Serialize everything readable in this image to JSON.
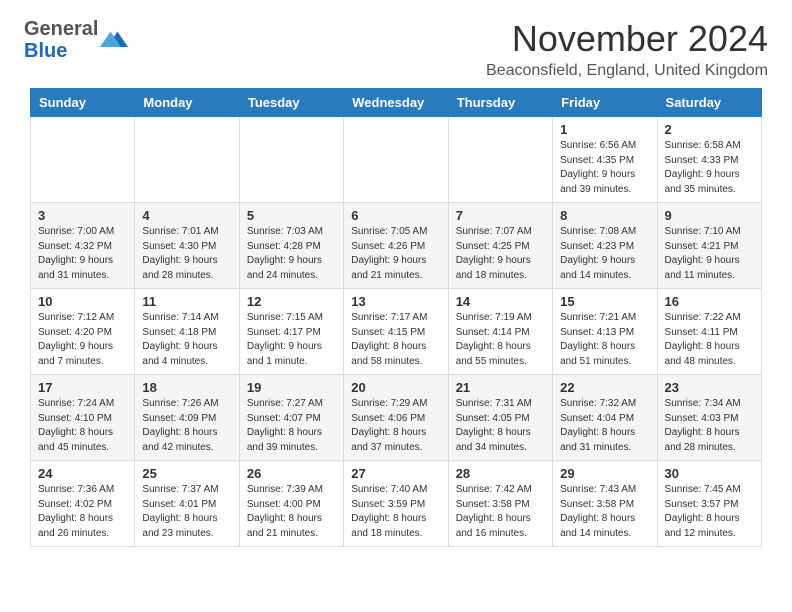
{
  "header": {
    "logo_general": "General",
    "logo_blue": "Blue",
    "month_title": "November 2024",
    "location": "Beaconsfield, England, United Kingdom"
  },
  "weekdays": [
    "Sunday",
    "Monday",
    "Tuesday",
    "Wednesday",
    "Thursday",
    "Friday",
    "Saturday"
  ],
  "weeks": [
    [
      {
        "day": "",
        "info": ""
      },
      {
        "day": "",
        "info": ""
      },
      {
        "day": "",
        "info": ""
      },
      {
        "day": "",
        "info": ""
      },
      {
        "day": "",
        "info": ""
      },
      {
        "day": "1",
        "info": "Sunrise: 6:56 AM\nSunset: 4:35 PM\nDaylight: 9 hours and 39 minutes."
      },
      {
        "day": "2",
        "info": "Sunrise: 6:58 AM\nSunset: 4:33 PM\nDaylight: 9 hours and 35 minutes."
      }
    ],
    [
      {
        "day": "3",
        "info": "Sunrise: 7:00 AM\nSunset: 4:32 PM\nDaylight: 9 hours and 31 minutes."
      },
      {
        "day": "4",
        "info": "Sunrise: 7:01 AM\nSunset: 4:30 PM\nDaylight: 9 hours and 28 minutes."
      },
      {
        "day": "5",
        "info": "Sunrise: 7:03 AM\nSunset: 4:28 PM\nDaylight: 9 hours and 24 minutes."
      },
      {
        "day": "6",
        "info": "Sunrise: 7:05 AM\nSunset: 4:26 PM\nDaylight: 9 hours and 21 minutes."
      },
      {
        "day": "7",
        "info": "Sunrise: 7:07 AM\nSunset: 4:25 PM\nDaylight: 9 hours and 18 minutes."
      },
      {
        "day": "8",
        "info": "Sunrise: 7:08 AM\nSunset: 4:23 PM\nDaylight: 9 hours and 14 minutes."
      },
      {
        "day": "9",
        "info": "Sunrise: 7:10 AM\nSunset: 4:21 PM\nDaylight: 9 hours and 11 minutes."
      }
    ],
    [
      {
        "day": "10",
        "info": "Sunrise: 7:12 AM\nSunset: 4:20 PM\nDaylight: 9 hours and 7 minutes."
      },
      {
        "day": "11",
        "info": "Sunrise: 7:14 AM\nSunset: 4:18 PM\nDaylight: 9 hours and 4 minutes."
      },
      {
        "day": "12",
        "info": "Sunrise: 7:15 AM\nSunset: 4:17 PM\nDaylight: 9 hours and 1 minute."
      },
      {
        "day": "13",
        "info": "Sunrise: 7:17 AM\nSunset: 4:15 PM\nDaylight: 8 hours and 58 minutes."
      },
      {
        "day": "14",
        "info": "Sunrise: 7:19 AM\nSunset: 4:14 PM\nDaylight: 8 hours and 55 minutes."
      },
      {
        "day": "15",
        "info": "Sunrise: 7:21 AM\nSunset: 4:13 PM\nDaylight: 8 hours and 51 minutes."
      },
      {
        "day": "16",
        "info": "Sunrise: 7:22 AM\nSunset: 4:11 PM\nDaylight: 8 hours and 48 minutes."
      }
    ],
    [
      {
        "day": "17",
        "info": "Sunrise: 7:24 AM\nSunset: 4:10 PM\nDaylight: 8 hours and 45 minutes."
      },
      {
        "day": "18",
        "info": "Sunrise: 7:26 AM\nSunset: 4:09 PM\nDaylight: 8 hours and 42 minutes."
      },
      {
        "day": "19",
        "info": "Sunrise: 7:27 AM\nSunset: 4:07 PM\nDaylight: 8 hours and 39 minutes."
      },
      {
        "day": "20",
        "info": "Sunrise: 7:29 AM\nSunset: 4:06 PM\nDaylight: 8 hours and 37 minutes."
      },
      {
        "day": "21",
        "info": "Sunrise: 7:31 AM\nSunset: 4:05 PM\nDaylight: 8 hours and 34 minutes."
      },
      {
        "day": "22",
        "info": "Sunrise: 7:32 AM\nSunset: 4:04 PM\nDaylight: 8 hours and 31 minutes."
      },
      {
        "day": "23",
        "info": "Sunrise: 7:34 AM\nSunset: 4:03 PM\nDaylight: 8 hours and 28 minutes."
      }
    ],
    [
      {
        "day": "24",
        "info": "Sunrise: 7:36 AM\nSunset: 4:02 PM\nDaylight: 8 hours and 26 minutes."
      },
      {
        "day": "25",
        "info": "Sunrise: 7:37 AM\nSunset: 4:01 PM\nDaylight: 8 hours and 23 minutes."
      },
      {
        "day": "26",
        "info": "Sunrise: 7:39 AM\nSunset: 4:00 PM\nDaylight: 8 hours and 21 minutes."
      },
      {
        "day": "27",
        "info": "Sunrise: 7:40 AM\nSunset: 3:59 PM\nDaylight: 8 hours and 18 minutes."
      },
      {
        "day": "28",
        "info": "Sunrise: 7:42 AM\nSunset: 3:58 PM\nDaylight: 8 hours and 16 minutes."
      },
      {
        "day": "29",
        "info": "Sunrise: 7:43 AM\nSunset: 3:58 PM\nDaylight: 8 hours and 14 minutes."
      },
      {
        "day": "30",
        "info": "Sunrise: 7:45 AM\nSunset: 3:57 PM\nDaylight: 8 hours and 12 minutes."
      }
    ]
  ]
}
